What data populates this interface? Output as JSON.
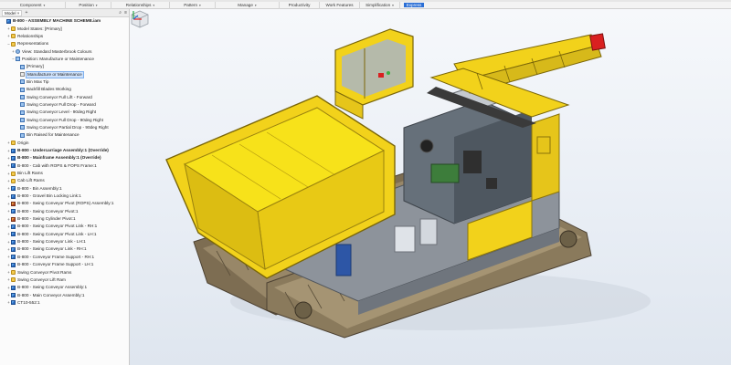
{
  "ribbon": {
    "groups": [
      {
        "label": "Component",
        "caret": "▾"
      },
      {
        "label": "Position",
        "caret": "▾"
      },
      {
        "label": "Relationships",
        "caret": "▾"
      },
      {
        "label": "Pattern",
        "caret": "▾"
      },
      {
        "label": "Manage",
        "caret": "▾"
      },
      {
        "label": "Productivity",
        "caret": ""
      },
      {
        "label": "Work Features",
        "caret": ""
      },
      {
        "label": "Simplification",
        "caret": "▾"
      },
      {
        "label": "Express",
        "caret": ""
      }
    ]
  },
  "browser": {
    "tab_label": "Model",
    "close_glyph": "×",
    "add_glyph": "+",
    "search_glyph": "⌕",
    "menu_glyph": "≡",
    "items": [
      {
        "label": "B-800 - ASSEMBLY MACHINE SCHEME.iam",
        "icon": "assembly-icon",
        "indent": 0,
        "bold": true,
        "expander": ""
      },
      {
        "label": "Model States: [Primary]",
        "icon": "folder-icon",
        "indent": 1,
        "expander": "+"
      },
      {
        "label": "Relationships",
        "icon": "folder-icon",
        "indent": 1,
        "expander": "+"
      },
      {
        "label": "Representations",
        "icon": "folder-icon",
        "indent": 1,
        "expander": "−"
      },
      {
        "label": "View: Standard Masterbrook Colours",
        "icon": "view-icon",
        "indent": 2,
        "expander": "+"
      },
      {
        "label": "Position: Manufacture or Maintenance",
        "icon": "position-icon",
        "indent": 2,
        "expander": "−"
      },
      {
        "label": "[Primary]",
        "icon": "position-icon",
        "indent": 3,
        "expander": ""
      },
      {
        "label": "Manufacture or Maintenance",
        "icon": "check-icon",
        "indent": 3,
        "expander": "",
        "selected": true
      },
      {
        "label": "Bin Max Tip",
        "icon": "position-icon",
        "indent": 3,
        "expander": ""
      },
      {
        "label": "Backfill Blades Working",
        "icon": "position-icon",
        "indent": 3,
        "expander": ""
      },
      {
        "label": "Swing Conveyor Full Lift - Forward",
        "icon": "position-icon",
        "indent": 3,
        "expander": ""
      },
      {
        "label": "Swing Conveyor Full Drop - Forward",
        "icon": "position-icon",
        "indent": 3,
        "expander": ""
      },
      {
        "label": "Swing Conveyor Level - 90deg Right",
        "icon": "position-icon",
        "indent": 3,
        "expander": ""
      },
      {
        "label": "Swing Conveyor Full Drop - 90deg Right",
        "icon": "position-icon",
        "indent": 3,
        "expander": ""
      },
      {
        "label": "Swing Conveyor Partial Drop - 90deg Right",
        "icon": "position-icon",
        "indent": 3,
        "expander": ""
      },
      {
        "label": "Bin Raised for Maintenance",
        "icon": "position-icon",
        "indent": 3,
        "expander": ""
      },
      {
        "label": "Origin",
        "icon": "folder-icon",
        "indent": 1,
        "expander": "+"
      },
      {
        "label": "B-800 - Undercarriage Assembly:1 (Override)",
        "icon": "assembly-icon",
        "indent": 1,
        "bold": true,
        "expander": "+"
      },
      {
        "label": "B-800 - Mainframe Assembly:1 (Override)",
        "icon": "assembly-icon",
        "indent": 1,
        "bold": true,
        "expander": "+"
      },
      {
        "label": "B-800 - Cab with ROPS & FOPS Frame:1",
        "icon": "assembly-icon",
        "indent": 1,
        "expander": "+"
      },
      {
        "label": "Bin Lift Rams",
        "icon": "folder-icon",
        "indent": 1,
        "expander": "+"
      },
      {
        "label": "Cab Lift Rams",
        "icon": "folder-icon",
        "indent": 1,
        "expander": "+"
      },
      {
        "label": "B-800 - Bin Assembly:1",
        "icon": "assembly-icon",
        "indent": 1,
        "expander": "+"
      },
      {
        "label": "B-800 - Gravel Bin Locking Link:1",
        "icon": "assembly-icon",
        "indent": 1,
        "expander": "+"
      },
      {
        "label": "B-800 - Swing Conveyor Pivot (ROPS) Assembly:1",
        "icon": "assembly-red-icon",
        "indent": 1,
        "expander": "+"
      },
      {
        "label": "B-800 - Swing Conveyor Pivot:1",
        "icon": "assembly-icon",
        "indent": 1,
        "expander": "+"
      },
      {
        "label": "B-800 - Swing Cylinder Pivot:1",
        "icon": "assembly-red-icon",
        "indent": 1,
        "expander": "+"
      },
      {
        "label": "B-800 - Swing Conveyor Pivot Link - RH:1",
        "icon": "assembly-icon",
        "indent": 1,
        "expander": "+"
      },
      {
        "label": "B-800 - Swing Conveyor Pivot Link - LH:1",
        "icon": "assembly-icon",
        "indent": 1,
        "expander": "+"
      },
      {
        "label": "B-800 - Swing Conveyor Link - LH:1",
        "icon": "assembly-icon",
        "indent": 1,
        "expander": "+"
      },
      {
        "label": "B-800 - Swing Conveyor Link - RH:1",
        "icon": "assembly-icon",
        "indent": 1,
        "expander": "+"
      },
      {
        "label": "B-800 - Conveyor Frame Support - RH:1",
        "icon": "assembly-icon",
        "indent": 1,
        "expander": "+"
      },
      {
        "label": "B-800 - Conveyor Frame Support - LH:1",
        "icon": "assembly-icon",
        "indent": 1,
        "expander": "+"
      },
      {
        "label": "Swing Conveyor Pivot Rams",
        "icon": "folder-icon",
        "indent": 1,
        "expander": "+"
      },
      {
        "label": "Swing Conveyor Lift Ram",
        "icon": "folder-icon",
        "indent": 1,
        "expander": "+"
      },
      {
        "label": "B-800 - Swing Conveyor Assembly:1",
        "icon": "assembly-icon",
        "indent": 1,
        "expander": "+"
      },
      {
        "label": "B-800 - Main Conveyor Assembly:1",
        "icon": "assembly-icon",
        "indent": 1,
        "expander": "+"
      },
      {
        "label": "CT10-552:1",
        "icon": "assembly-icon",
        "indent": 1,
        "expander": "+"
      }
    ]
  },
  "viewport": {
    "viewcube_icon": "viewcube-icon",
    "triad_icon": "axis-triad-icon",
    "colors": {
      "machine_yellow": "#f2d21b",
      "bin_yellow": "#f7e21a",
      "track_brown": "#9a8a6a",
      "chassis_grey": "#8d939b",
      "accent_red": "#d92020"
    }
  }
}
